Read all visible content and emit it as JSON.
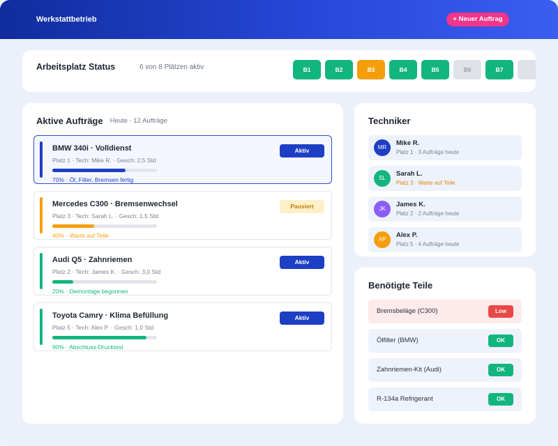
{
  "header": {
    "brand": "Werkstattbetrieb",
    "new_order_label": "+ Neuer Auftrag"
  },
  "status": {
    "title": "Arbeitsplatz Status",
    "summary": "6 von 8 Plätzen aktiv",
    "bays": [
      {
        "label": "B1",
        "state": "active"
      },
      {
        "label": "B2",
        "state": "active"
      },
      {
        "label": "B3",
        "state": "waiting"
      },
      {
        "label": "B4",
        "state": "active"
      },
      {
        "label": "B5",
        "state": "active"
      },
      {
        "label": "B6",
        "state": "free"
      },
      {
        "label": "B7",
        "state": "active"
      },
      {
        "label": "",
        "state": "free"
      }
    ]
  },
  "orders": {
    "title": "Aktive Aufträge",
    "subtitle": "Heute · 12 Aufträge",
    "items": [
      {
        "title": "BMW 340i · Volldienst",
        "meta": "Platz 1 · Tech: Mike R. · Gesch: 2,5 Std",
        "progress": 0.7,
        "note": "70% · Öl, Filter, Bremsen fertig",
        "status": "Aktiv",
        "color": "#1d3fc4"
      },
      {
        "title": "Mercedes C300 · Bremsenwechsel",
        "meta": "Platz 3 · Tech: Sarah L. · Gesch: 1,5 Std",
        "progress": 0.4,
        "note": "40% · Warte auf Teile",
        "status": "Pausiert",
        "color": "#f59e0b"
      },
      {
        "title": "Audi Q5 · Zahnriemen",
        "meta": "Platz 2 · Tech: James K. · Gesch: 3,0 Std",
        "progress": 0.2,
        "note": "20% · Demontage begonnen",
        "status": "Aktiv",
        "color": "#13b57e"
      },
      {
        "title": "Toyota Camry · Klima Befüllung",
        "meta": "Platz 5 · Tech: Alex P. · Gesch: 1,0 Std",
        "progress": 0.9,
        "note": "90% · Abschluss-Drucktest",
        "status": "Aktiv",
        "color": "#13b57e"
      }
    ]
  },
  "technicians": {
    "title": "Techniker",
    "items": [
      {
        "initials": "MR",
        "name": "Mike R.",
        "info": "Platz 1 · 3 Aufträge heute",
        "avatar_color": "#1d3fc4",
        "info_color": "#7a8191"
      },
      {
        "initials": "SL",
        "name": "Sarah L.",
        "info": "Platz 3 · Warte auf Teile",
        "avatar_color": "#13b57e",
        "info_color": "#e0870b"
      },
      {
        "initials": "JK",
        "name": "James K.",
        "info": "Platz 2 · 2 Aufträge heute",
        "avatar_color": "#8b5cf6",
        "info_color": "#7a8191"
      },
      {
        "initials": "AP",
        "name": "Alex P.",
        "info": "Platz 5 · 4 Aufträge heute",
        "avatar_color": "#f59e0b",
        "info_color": "#7a8191"
      }
    ]
  },
  "parts": {
    "title": "Benötigte Teile",
    "items": [
      {
        "name": "Bremsbeläge (C300)",
        "status": "Low",
        "level": "low"
      },
      {
        "name": "Ölfilter (BMW)",
        "status": "OK",
        "level": "ok"
      },
      {
        "name": "Zahnriemen-Kit (Audi)",
        "status": "OK",
        "level": "ok"
      },
      {
        "name": "R-134a Refrigerant",
        "status": "OK",
        "level": "ok"
      }
    ]
  },
  "colors": {
    "accent": "#1d3fc4",
    "success": "#13b57e",
    "warning": "#f59e0b",
    "danger": "#e94848",
    "cta": "#f0358a"
  }
}
